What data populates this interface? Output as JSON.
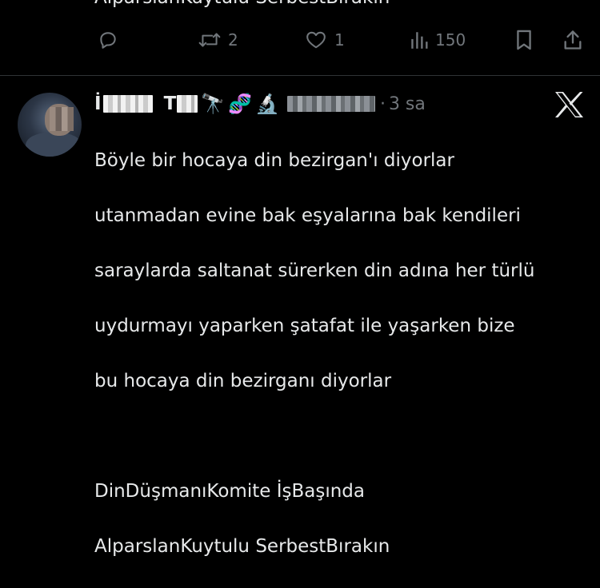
{
  "previous_tweet": {
    "tail_text": "AlparslanKuytulu SerbestBırakın",
    "actions": {
      "reply_count": "",
      "retweet_count": "2",
      "like_count": "1",
      "views_count": "150"
    }
  },
  "reply_tweet": {
    "author": {
      "name_first_char": "İ",
      "name_second_char": "T",
      "emojis": [
        "🔭",
        "🧬",
        "🔬"
      ]
    },
    "time_separator": "·",
    "time": "3 sa",
    "text_lines": [
      "Böyle bir hocaya din bezirgan'ı diyorlar",
      "utanmadan evine bak eşyalarına bak kendileri",
      "saraylarda saltanat sürerken din adına her türlü",
      "uydurmayı yaparken şatafat ile yaşarken bize",
      "bu hocaya din bezirganı diyorlar",
      "",
      "DinDüşmanıKomite İşBaşında",
      "AlparslanKuytulu SerbestBırakın"
    ]
  },
  "colors": {
    "background": "#000000",
    "text_primary": "#e7e9ea",
    "text_secondary": "#71767b",
    "divider": "#2f3336"
  },
  "icons": {
    "reply": "speech-bubble-icon",
    "retweet": "retweet-arrows-icon",
    "like": "heart-icon",
    "views": "bar-chart-icon",
    "bookmark": "bookmark-icon",
    "share": "share-upload-icon",
    "brand": "x-logo-icon"
  }
}
